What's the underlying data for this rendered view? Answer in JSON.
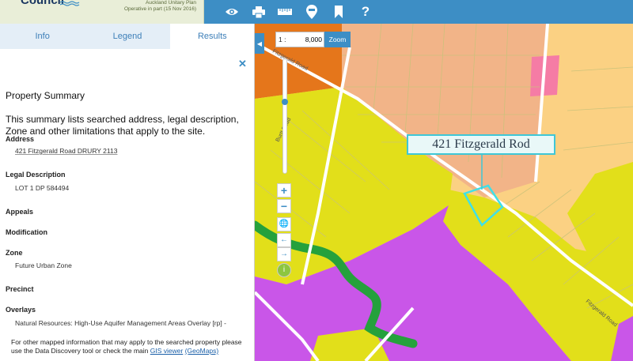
{
  "header": {
    "brand": "Council",
    "plan_name": "Auckland Unitary Plan",
    "plan_status": "Operative in part (15 Nov 2016)",
    "toolbar": [
      {
        "name": "eye-icon",
        "label": ""
      },
      {
        "name": "print-icon",
        "label": ""
      },
      {
        "name": "ruler-icon",
        "label": ""
      },
      {
        "name": "map-pin-icon",
        "label": ""
      },
      {
        "name": "bookmark-icon",
        "label": ""
      },
      {
        "name": "help-icon",
        "label": "?"
      }
    ]
  },
  "tabs": [
    {
      "label": "Info"
    },
    {
      "label": "Legend"
    },
    {
      "label": "Results",
      "active": true
    }
  ],
  "summary": {
    "title": "Property Summary",
    "description": "This summary lists searched address, legal description, Zone and other limitations that apply to the site.",
    "address_label": "Address",
    "address_value": "421 Fitzgerald Road DRURY 2113",
    "legal_label": "Legal Description",
    "legal_value": "LOT 1 DP 584494",
    "appeals_label": "Appeals",
    "modification_label": "Modification",
    "zone_label": "Zone",
    "zone_value": "Future Urban Zone",
    "precinct_label": "Precinct",
    "overlays_label": "Overlays",
    "overlays_value": "Natural Resources: High-Use Aquifer Management Areas Overlay [rp] -",
    "footer_text": "For other mapped information that may apply to the searched property please use the Data Discovery tool or check the main",
    "footer_link": "GIS viewer",
    "footer_tail": "(GeoMaps)"
  },
  "map": {
    "scale_prefix": "1 :",
    "scale_value": "8,000",
    "zoom_label": "Zoom",
    "zoom_in": "+",
    "zoom_out": "−",
    "callout": "421 Fitzgerald Rod",
    "road_label_1": "Fitzgerald Road",
    "road_label_2": "Fitzgerald Road",
    "road_label_3": "Burtt Road",
    "colors": {
      "future_urban": "#e2df1a",
      "rural": "#c956e8",
      "residential": "#f2b488",
      "light_residential": "#fbd183",
      "business": "#e5761b",
      "river": "#25a13c",
      "parcel_outline": "#3fe0e8"
    }
  }
}
